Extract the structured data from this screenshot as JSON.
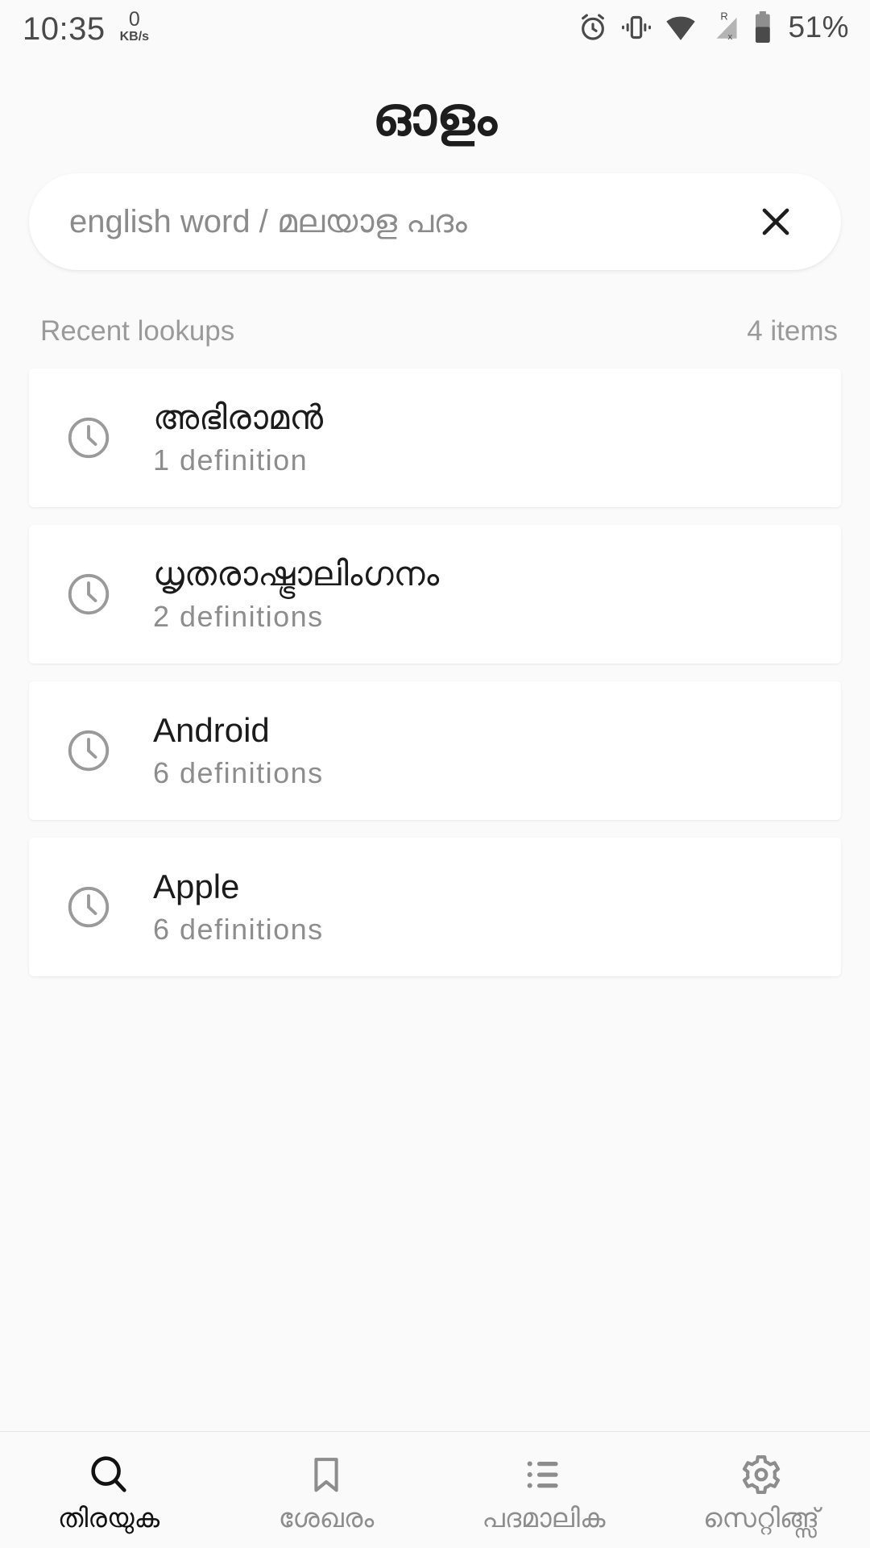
{
  "statusbar": {
    "time": "10:35",
    "net_speed_value": "0",
    "net_speed_unit": "KB/s",
    "battery_percent": "51%",
    "icons": [
      "alarm-icon",
      "vibrate-icon",
      "wifi-icon",
      "signal-roaming-icon",
      "battery-icon"
    ]
  },
  "header": {
    "title": "ഓളം"
  },
  "search": {
    "value": "",
    "placeholder": "english word / മലയാള പദം",
    "clear_icon": "close-icon"
  },
  "recent": {
    "label": "Recent lookups",
    "count": "4 items",
    "items": [
      {
        "word": "അഭിരാമൻ",
        "definitions": "1 definition",
        "icon": "clock-icon"
      },
      {
        "word": "ധൃതരാഷ്ട്രാലിംഗനം",
        "definitions": "2 definitions",
        "icon": "clock-icon"
      },
      {
        "word": "Android",
        "definitions": "6 definitions",
        "icon": "clock-icon"
      },
      {
        "word": "Apple",
        "definitions": "6 definitions",
        "icon": "clock-icon"
      }
    ]
  },
  "bottom_nav": {
    "items": [
      {
        "label": "തിരയുക",
        "icon": "search-icon",
        "active": true
      },
      {
        "label": "ശേഖരം",
        "icon": "bookmark-icon",
        "active": false
      },
      {
        "label": "പദമാലിക",
        "icon": "list-icon",
        "active": false
      },
      {
        "label": "സെറ്റിങ്ങ്സ്",
        "icon": "gear-icon",
        "active": false
      }
    ]
  },
  "colors": {
    "page_background": "#fafafa",
    "card_background": "#ffffff",
    "primary_text": "#1b1b1b",
    "secondary_text": "#8d8d8d",
    "icon_gray": "#8d8d8d"
  }
}
